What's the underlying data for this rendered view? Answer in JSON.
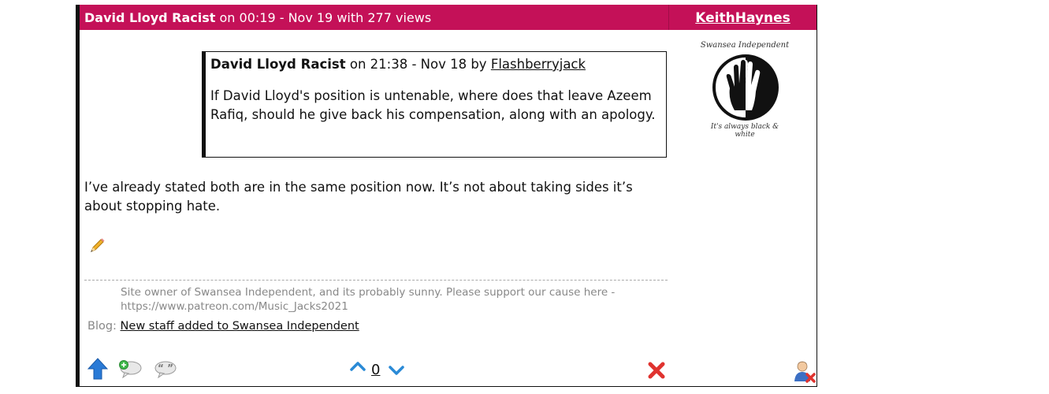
{
  "post": {
    "header": {
      "title": "David Lloyd Racist",
      "meta": " on 00:19 - Nov 19 with 277 views",
      "author": "KeithHaynes"
    },
    "quote": {
      "title": "David Lloyd Racist",
      "meta": " on 21:38 - Nov 18 by ",
      "author": "Flashberryjack",
      "body": "If David Lloyd's position is untenable, where does that leave Azeem Rafiq, should he give back his compensation, along with an apology."
    },
    "reply": "I’ve already stated both are in the same position now. It’s not about taking sides it’s about stopping hate.",
    "signature": "Site owner of Swansea Independent, and its probably sunny. Please support our cause here - https://www.patreon.com/Music_Jacks2021",
    "blog": {
      "label": "Blog: ",
      "link": "New staff added to Swansea Independent"
    },
    "votes": "0",
    "avatar": {
      "top_text": "Swansea Independent",
      "bottom_text": "It's always black & white"
    }
  },
  "colors": {
    "header_bg": "#c41158",
    "arrow_blue": "#2a7ad6",
    "delete_red": "#e0332f"
  },
  "icons": [
    "edit-pencil-icon",
    "back-to-top-icon",
    "reply-icon",
    "quote-icon",
    "vote-up-icon",
    "vote-down-icon",
    "delete-icon",
    "ignore-user-icon"
  ]
}
